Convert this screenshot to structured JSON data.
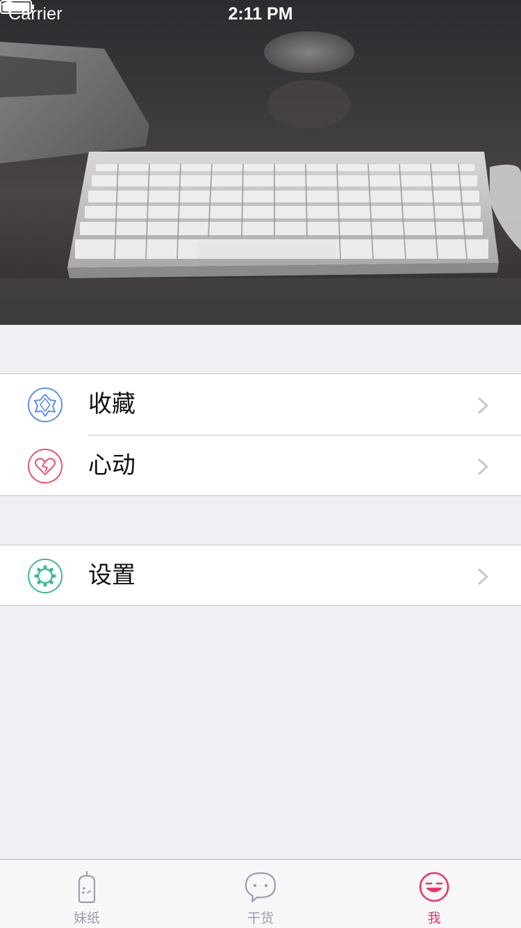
{
  "status_bar": {
    "carrier": "Carrier",
    "time": "2:11 PM"
  },
  "hero": {
    "image": "keyboard-on-desk-photo"
  },
  "menu": {
    "group1": [
      {
        "label": "收藏",
        "icon": "favorites-star-icon",
        "color": "#5b8ff0"
      },
      {
        "label": "心动",
        "icon": "broken-heart-icon",
        "color": "#f0516c"
      }
    ],
    "group2": [
      {
        "label": "设置",
        "icon": "settings-gear-icon",
        "color": "#3dba8e"
      }
    ]
  },
  "tab_bar": {
    "items": [
      {
        "label": "妹纸",
        "icon": "bottle-face-icon",
        "selected": false
      },
      {
        "label": "干货",
        "icon": "chat-bubble-icon",
        "selected": false
      },
      {
        "label": "我",
        "icon": "smiley-face-icon",
        "selected": true
      }
    ],
    "active_color": "#f0316c",
    "inactive_color": "#9a9fb0"
  },
  "colors": {
    "background": "#efeff4",
    "separator": "#c8c7cc",
    "chevron": "#c7c7cc"
  }
}
